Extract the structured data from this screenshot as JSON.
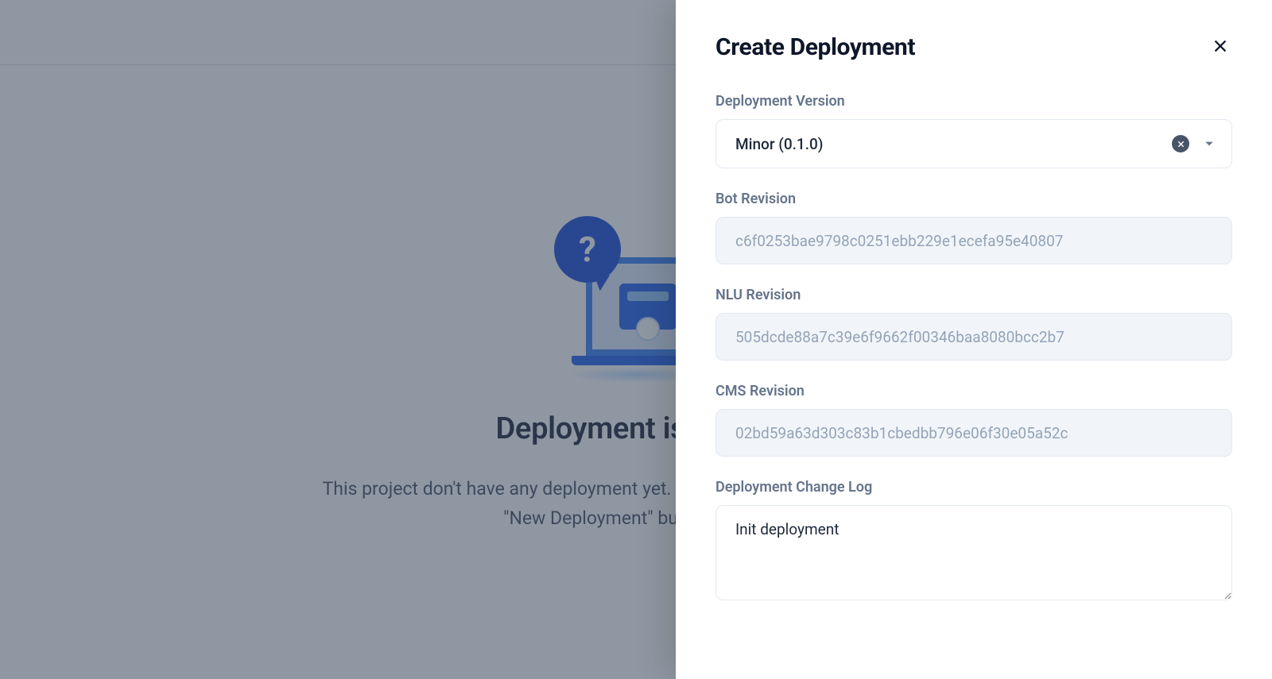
{
  "empty_state": {
    "title": "Deployment is empty",
    "description": "This project don't have any deployment yet. Create deployment by clicking the \"New Deployment\" button above."
  },
  "drawer": {
    "title": "Create Deployment",
    "fields": {
      "version_label": "Deployment Version",
      "version_value": "Minor (0.1.0)",
      "bot_revision_label": "Bot Revision",
      "bot_revision_value": "c6f0253bae9798c0251ebb229e1ecefa95e40807",
      "nlu_revision_label": "NLU Revision",
      "nlu_revision_value": "505dcde88a7c39e6f9662f00346baa8080bcc2b7",
      "cms_revision_label": "CMS Revision",
      "cms_revision_value": "02bd59a63d303c83b1cbedbb796e06f30e05a52c",
      "changelog_label": "Deployment Change Log",
      "changelog_value": "Init deployment"
    }
  }
}
